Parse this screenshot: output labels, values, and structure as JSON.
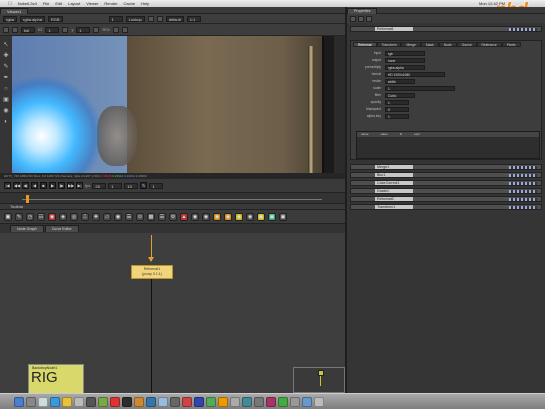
{
  "menubar": {
    "items": [
      "Nuke6.3v4",
      "File",
      "Edit",
      "Layout",
      "Viewer",
      "Render",
      "Cache",
      "Help"
    ],
    "right": "Mon 12:42 PM"
  },
  "brand": {
    "text": "phd",
    "color": "#f08a1c"
  },
  "viewer_tab": "Viewer1",
  "viewer_toolbar": {
    "channels": "rgba",
    "channel_select": "rgba.alpha",
    "display": "RGB",
    "zoom": "1:1",
    "lut": "default",
    "gain_label": "f/2",
    "gain_value": "1",
    "gamma_label": "y",
    "gamma_value": "1",
    "proxy": "full",
    "input": "1",
    "input_process": "Lookup",
    "roi_label": "ROI"
  },
  "viewer_status": {
    "format": "HDTV_720 1280x720",
    "bbox": "bbox: 0 0 1280 720",
    "channels": "channels: rgba",
    "coord": "x=1207 y=461",
    "values": [
      "0.18039",
      "0.24314",
      "0.24314",
      "1.00000"
    ]
  },
  "transport": {
    "fps_label": "fps",
    "fps": "25",
    "frame": "1",
    "increment": "10",
    "end": "1"
  },
  "node_graph": {
    "tab_title": "Toolbar",
    "tabs": [
      "Node Graph",
      "Curve Editor"
    ],
    "node1": {
      "title": "Reformat1",
      "sub": "(proxy 0 1:1)"
    },
    "node2": {
      "title": "BackdropNode1",
      "big": "RIG"
    }
  },
  "properties": {
    "tab": "Properties",
    "node_name": "Reformat1",
    "tabs": [
      "Reformat",
      "Transform",
      "Merge",
      "Mask",
      "Node",
      "Gamut",
      "Reference",
      "Pixels"
    ],
    "rows": [
      {
        "k": "input",
        "v": "rgb"
      },
      {
        "k": "output",
        "v": "none"
      },
      {
        "k": "premultiply",
        "v": "rgba.alpha"
      },
      {
        "k": "format",
        "v": "HD 1920x1080"
      },
      {
        "k": "resize",
        "v": "width"
      },
      {
        "k": "scale",
        "v": "1"
      },
      {
        "k": "filter",
        "v": "Cubic"
      },
      {
        "k": "opacity",
        "v": "1"
      },
      {
        "k": "blackpoint",
        "v": "0"
      },
      {
        "k": "alpha key",
        "v": "1"
      }
    ],
    "table_headers": [
      "name",
      "value",
      "kf",
      "expr"
    ],
    "collapsed_panels": [
      "Merge1",
      "Blur1",
      "ColorCorrect1",
      "Grade1",
      "Reformat2",
      "Transform1"
    ]
  }
}
